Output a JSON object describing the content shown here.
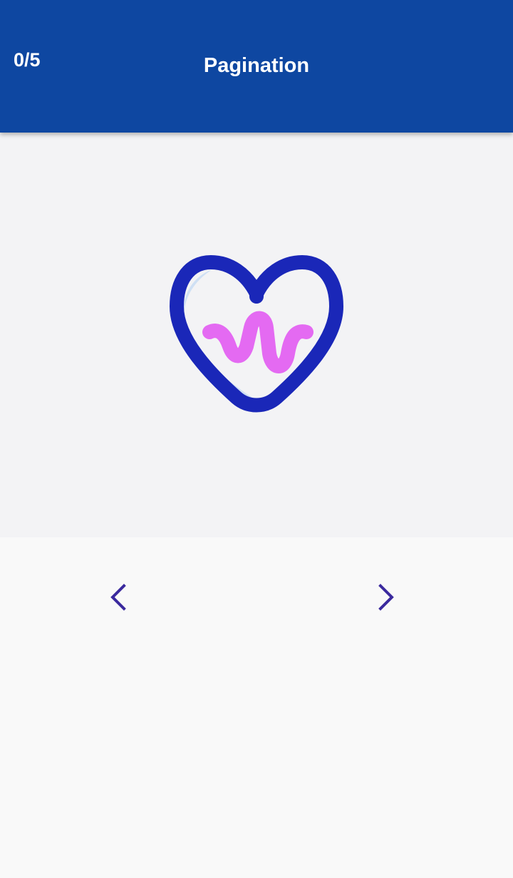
{
  "app_bar": {
    "page_counter": "0/5",
    "title": "Pagination",
    "background_color": "#0e47a1",
    "text_color": "#ffffff"
  },
  "content": {
    "illustration_icon": "heart-pulse-icon",
    "panel_color": "#f3f3f5",
    "heart_outline_color": "#1a27b8",
    "heart_shadow_color": "#cfe0f4",
    "pulse_color": "#e46af2"
  },
  "navigation": {
    "previous_icon": "chevron-left-icon",
    "next_icon": "chevron-right-icon",
    "icon_color": "#3b2a9e"
  }
}
